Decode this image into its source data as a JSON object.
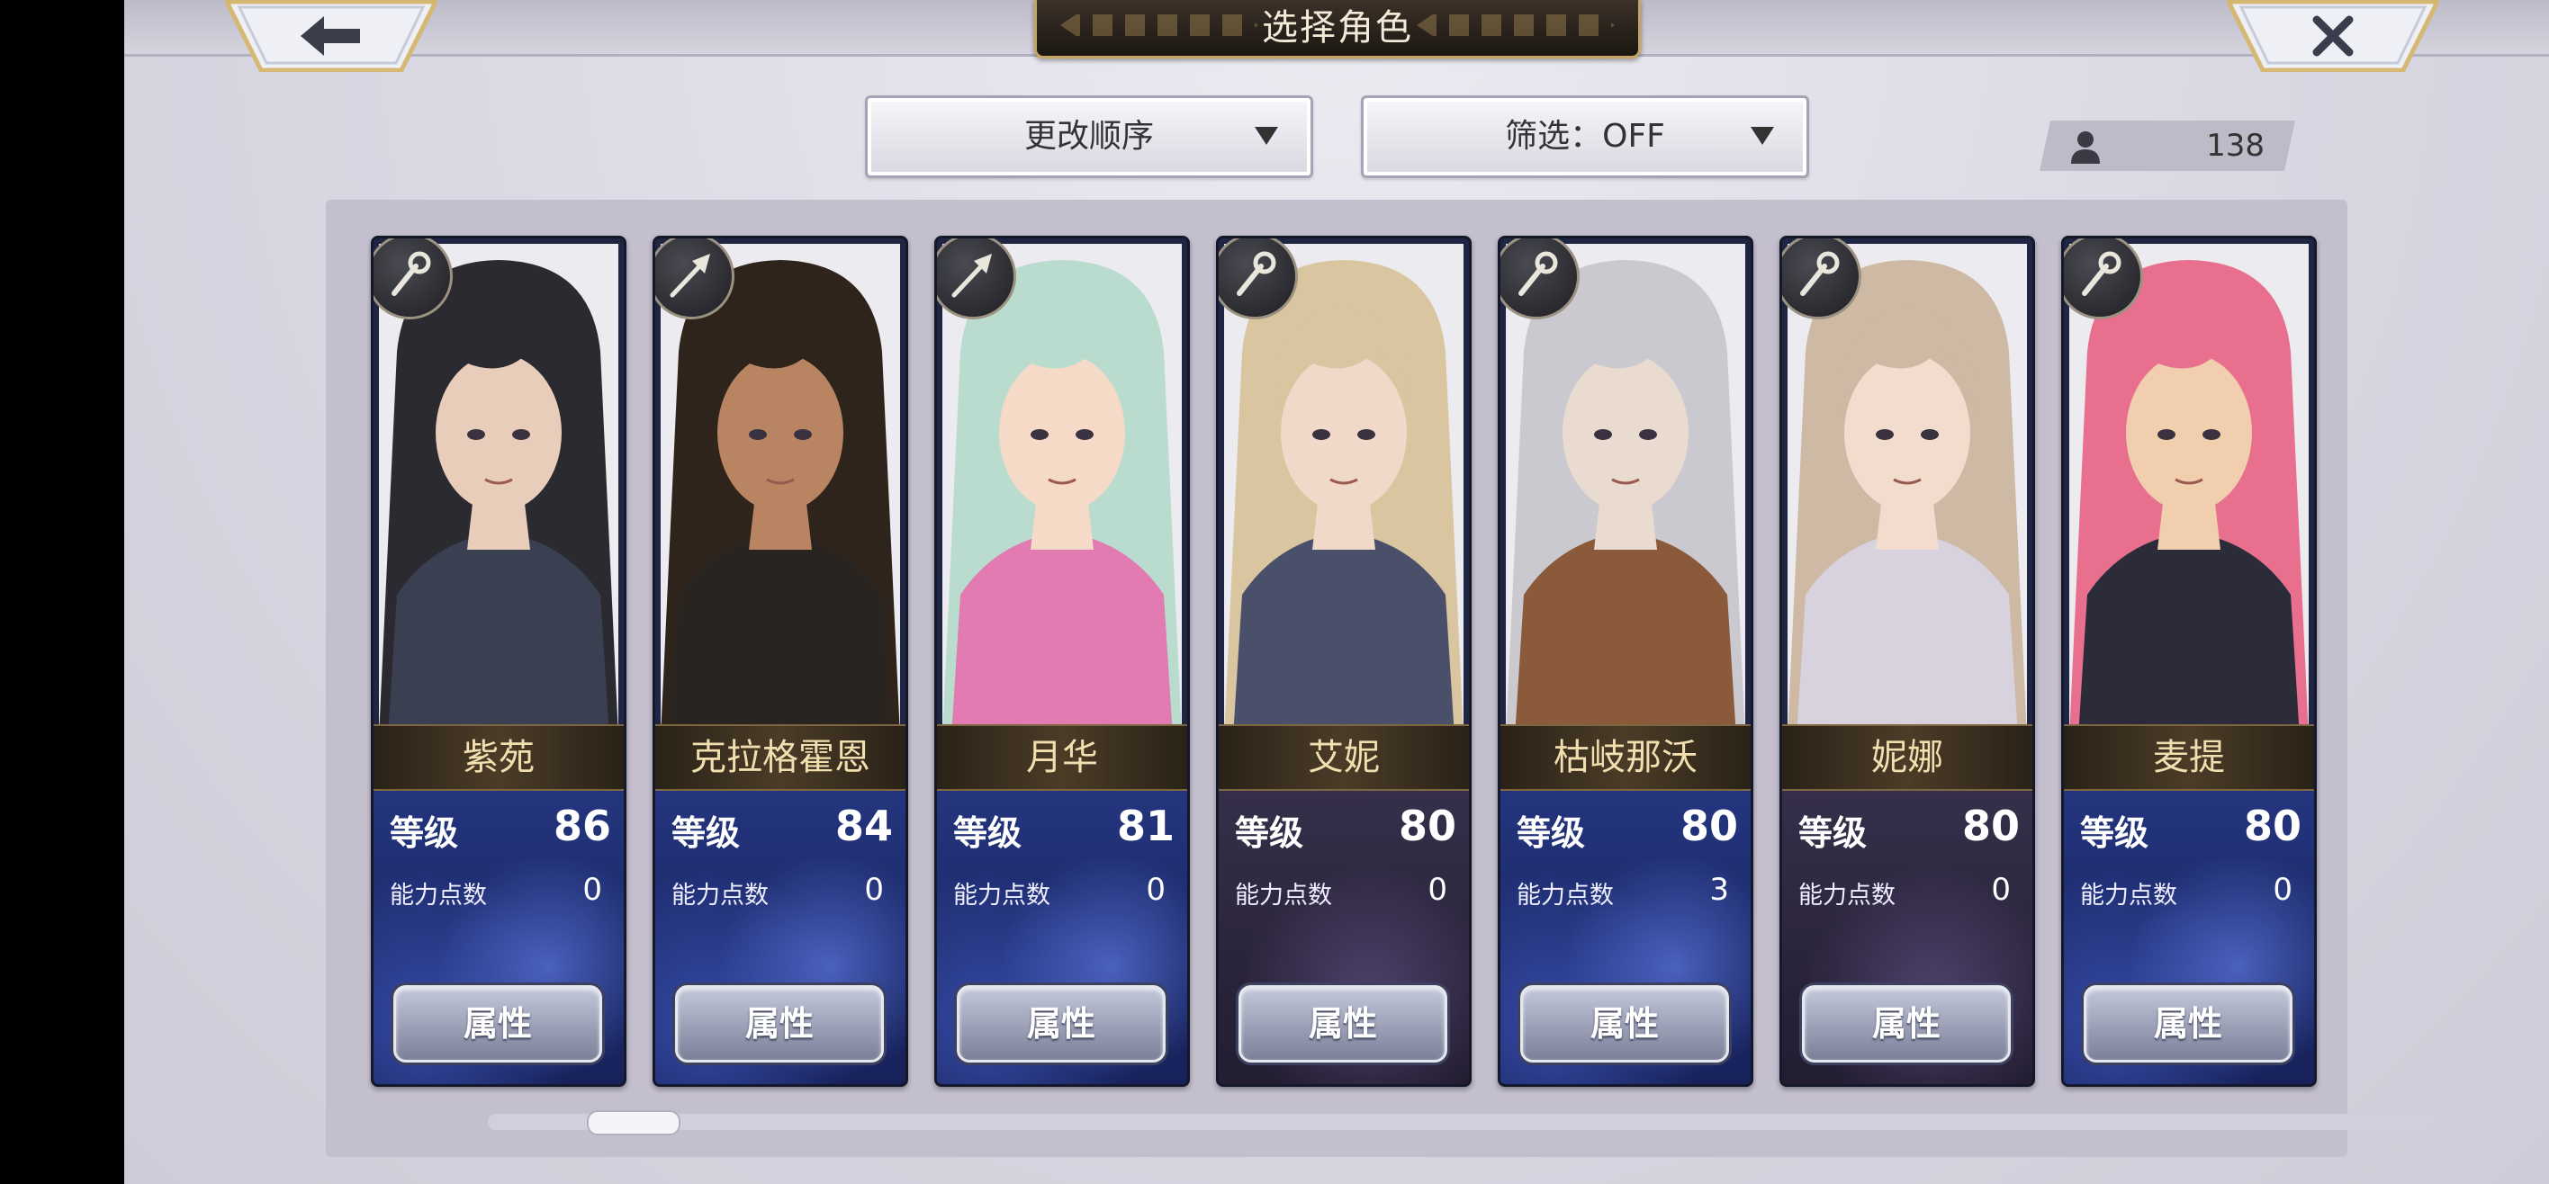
{
  "header": {
    "title": "选择角色",
    "back_icon": "arrow-left-icon",
    "close_icon": "close-x-icon"
  },
  "toolbar": {
    "sort_label": "更改顺序",
    "filter_label": "筛选：OFF",
    "character_count": "138"
  },
  "labels": {
    "level": "等级",
    "ability_points": "能力点数",
    "attributes_button": "属性"
  },
  "colors": {
    "name_text": "#f2dfb0",
    "card_blue": "#24357e",
    "gold_accent": "#c6a461"
  },
  "characters": [
    {
      "name": "紫苑",
      "level": "86",
      "points": "0",
      "weapon_icon": "staff-icon",
      "hair": "#2a2a30",
      "skin": "#e9cdbb",
      "outfit": "#3a3f52",
      "style": "blue"
    },
    {
      "name": "克拉格霍恩",
      "level": "84",
      "points": "0",
      "weapon_icon": "spear-icon",
      "hair": "#2f241c",
      "skin": "#b98462",
      "outfit": "#2a2420",
      "style": "blue"
    },
    {
      "name": "月华",
      "level": "81",
      "points": "0",
      "weapon_icon": "spear-icon",
      "hair": "#b9dccf",
      "skin": "#f5dac8",
      "outfit": "#e27bb2",
      "style": "blue"
    },
    {
      "name": "艾妮",
      "level": "80",
      "points": "0",
      "weapon_icon": "staff-icon",
      "hair": "#d9c5a0",
      "skin": "#f0d9c8",
      "outfit": "#4a4f6a",
      "style": "dark"
    },
    {
      "name": "枯岐那沃",
      "level": "80",
      "points": "3",
      "weapon_icon": "staff-icon",
      "hair": "#c9c9cf",
      "skin": "#eadbd0",
      "outfit": "#8a5a3a",
      "style": "blue"
    },
    {
      "name": "妮娜",
      "level": "80",
      "points": "0",
      "weapon_icon": "staff-icon",
      "hair": "#cdb9a4",
      "skin": "#f2dccd",
      "outfit": "#d7d2de",
      "style": "dark"
    },
    {
      "name": "麦提",
      "level": "80",
      "points": "0",
      "weapon_icon": "staff-icon",
      "hair": "#e8708e",
      "skin": "#f1cfae",
      "outfit": "#2c2b3a",
      "style": "blue"
    }
  ]
}
